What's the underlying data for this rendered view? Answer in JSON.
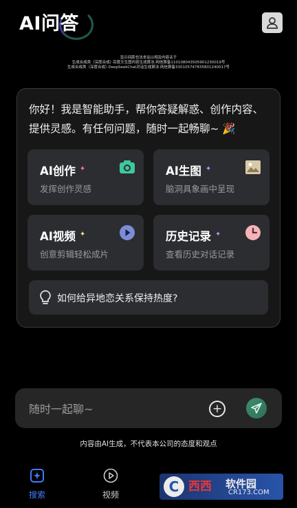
{
  "header": {
    "title": "AI问答",
    "profile_icon": "user-icon",
    "registration_lines": [
      "显示间距也法本站以相及内容关于",
      "生成合成类（深度合成）·百度文生图内容生成算法·网信算备110108043505901230019号",
      "生成合成类（深度合成）·DeepSeekChat对话生成算法·网信算备330105747835801240017号"
    ]
  },
  "card": {
    "greeting": "你好！我是智能助手，帮你答疑解惑、创作内容、提供灵感。有任何问题，随时一起畅聊~ 🎉",
    "tiles": [
      {
        "title": "AI创作",
        "subtitle": "发挥创作灵感",
        "icon": "camera-icon",
        "spark_color": "#ff7aa0"
      },
      {
        "title": "AI生图",
        "subtitle": "脑洞具象画中呈现",
        "icon": "image-icon",
        "spark_color": "#8fa8ff"
      },
      {
        "title": "AI视频",
        "subtitle": "创意剪辑轻松成片",
        "icon": "play-icon",
        "spark_color": "#ffe27a"
      },
      {
        "title": "历史记录",
        "subtitle": "查看历史对话记录",
        "icon": "clock-icon",
        "spark_color": "#c98aff"
      }
    ],
    "suggestion": "如何给异地恋关系保持热度?"
  },
  "chat": {
    "placeholder": "随时一起聊~"
  },
  "disclaimer": "内容由AI生成，不代表本公司的态度和观点",
  "nav": [
    {
      "label": "搜索",
      "icon": "sparkle-search-icon",
      "active": true,
      "color": "#3f7cff"
    },
    {
      "label": "视频",
      "icon": "play-circle-icon",
      "active": false
    }
  ],
  "watermark": {
    "logo": "C",
    "brand": "西西",
    "name": "软件园",
    "domain": "CR173.COM"
  }
}
